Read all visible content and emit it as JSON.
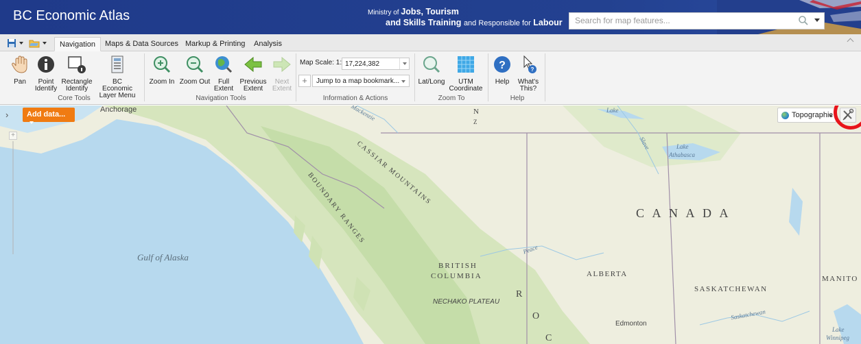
{
  "header": {
    "app_title": "BC Economic Atlas",
    "ministry_prefix": "Ministry of",
    "ministry_bold_1": "Jobs, Tourism",
    "ministry_bold_2": "and Skills Training",
    "ministry_middle": "and Responsible for",
    "ministry_bold_3": "Labour",
    "search_placeholder": "Search for map features..."
  },
  "ribbon": {
    "tabs": [
      "Navigation",
      "Maps & Data Sources",
      "Markup & Printing",
      "Analysis"
    ],
    "active_tab": "Navigation",
    "buttons": {
      "pan": "Pan",
      "point_identify": "Point Identify",
      "rectangle_identify": "Rectangle Identify",
      "layer_menu": "BC Economic Layer Menu",
      "zoom_in": "Zoom In",
      "zoom_out": "Zoom Out",
      "full_extent": "Full Extent",
      "previous_extent": "Previous Extent",
      "next_extent": "Next Extent",
      "latlong": "Lat/Long",
      "utm": "UTM Coordinate",
      "help": "Help",
      "whats_this": "What's This?"
    },
    "groups": {
      "core_tools": "Core Tools",
      "navigation_tools": "Navigation Tools",
      "info_actions": "Information & Actions",
      "zoom_to": "Zoom To",
      "help": "Help"
    },
    "map_scale_label": "Map Scale: 1:",
    "map_scale_value": "17,224,382",
    "bookmark_placeholder": "Jump to a map bookmark..."
  },
  "map": {
    "add_data_label": "Add data...",
    "basemap_label": "Topographic",
    "labels": {
      "anchorage": "Anchorage",
      "gulf_of_alaska": "Gulf of Alaska",
      "cassiar": "CASSIAR MOUNTAINS",
      "boundary": "BOUNDARY RANGES",
      "british_columbia_1": "BRITISH",
      "british_columbia_2": "COLUMBIA",
      "nechako": "NECHAKO PLATEAU",
      "canada": "C A N A D A",
      "alberta": "ALBERTA",
      "saskatchewan": "SASKATCHEWAN",
      "manitoba": "MANITO",
      "edmonton": "Edmonton",
      "lake_athabasca_1": "Lake",
      "lake_athabasca_2": "Athabasca",
      "lake_top": "Lake",
      "lake_winnipeg_1": "Lake",
      "lake_winnipeg_2": "Winnipeg",
      "peace": "Peace",
      "mackenzie": "Mackenzie",
      "slave": "Slave",
      "saskatchewan_river": "Saskatchewan",
      "rocky_r": "R",
      "rocky_o": "O",
      "rocky_c": "C",
      "northern_n": "N",
      "northern_z": "Z"
    }
  },
  "colors": {
    "header_bg": "#1f3a8a",
    "add_data": "#f07b12",
    "highlight": "#e8141b",
    "ocean": "#b7d9ee",
    "land": "#eeeedf"
  }
}
